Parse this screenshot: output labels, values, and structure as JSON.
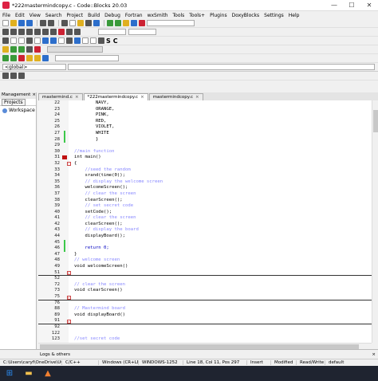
{
  "window": {
    "title": "*222mastermindcopy.c - Code::Blocks 20.03",
    "minimize": "—",
    "maximize": "☐",
    "close": "✕"
  },
  "menu": [
    "File",
    "Edit",
    "View",
    "Search",
    "Project",
    "Build",
    "Debug",
    "Fortran",
    "wxSmith",
    "Tools",
    "Tools+",
    "Plugins",
    "DoxyBlocks",
    "Settings",
    "Help"
  ],
  "scope": {
    "value": "<global>"
  },
  "management": {
    "title": "Management",
    "close": "×",
    "tab": "Projects",
    "workspace": "Workspace"
  },
  "tabs": [
    {
      "label": "mastermind.c",
      "active": false
    },
    {
      "label": "*222mastermindcopy.c",
      "active": true
    },
    {
      "label": "mastermindcopy.c",
      "active": false
    }
  ],
  "colors": {
    "breakpoint": "#c01010",
    "change_marker": "#3cc84a",
    "comment": "#8888ff",
    "number": "#f07000"
  },
  "lines": [
    {
      "n": "22",
      "code": "        NAVY,"
    },
    {
      "n": "23",
      "code": "        ORANGE,"
    },
    {
      "n": "24",
      "code": "        PINK,"
    },
    {
      "n": "25",
      "code": "        RED,"
    },
    {
      "n": "26",
      "code": "        VIOLET,"
    },
    {
      "n": "27",
      "code": "        WHITE",
      "green": true
    },
    {
      "n": "28",
      "code": "        }",
      "green": true,
      "fold_end": true
    },
    {
      "n": "29",
      "code": ""
    },
    {
      "n": "30",
      "code": "//main function",
      "cls": "c-com"
    },
    {
      "n": "31",
      "code": "int main()",
      "bp": true
    },
    {
      "n": "32",
      "code": "{",
      "fold": true
    },
    {
      "n": "33",
      "code": "    //seed the random",
      "cls": "c-com"
    },
    {
      "n": "34",
      "code": "    srand(time(0));"
    },
    {
      "n": "35",
      "code": "    // display the welcome screen",
      "cls": "c-com"
    },
    {
      "n": "36",
      "code": "    welcomeScreen();"
    },
    {
      "n": "37",
      "code": "    // clear the screen",
      "cls": "c-com"
    },
    {
      "n": "38",
      "code": "    clearScreen();"
    },
    {
      "n": "39",
      "code": "    // set secret code",
      "cls": "c-com"
    },
    {
      "n": "40",
      "code": "    setCode();"
    },
    {
      "n": "41",
      "code": "    // clear the screen",
      "cls": "c-com"
    },
    {
      "n": "42",
      "code": "    clearScreen();"
    },
    {
      "n": "43",
      "code": "    // display the board",
      "cls": "c-com"
    },
    {
      "n": "44",
      "code": "    displayBoard();"
    },
    {
      "n": "45",
      "code": "",
      "green": true
    },
    {
      "n": "46",
      "code": "    return 0;",
      "green": true,
      "kw": true
    },
    {
      "n": "47",
      "code": "}",
      "fold_end": true
    },
    {
      "n": "48",
      "code": "// welcome screen",
      "cls": "c-com"
    },
    {
      "n": "49",
      "code": "void welcomeScreen()"
    },
    {
      "n": "51",
      "code": "",
      "collapsed": true
    },
    {
      "n": "52",
      "code": ""
    },
    {
      "n": "72",
      "code": "// clear the screen",
      "cls": "c-com"
    },
    {
      "n": "73",
      "code": "void clearScreen()"
    },
    {
      "n": "75",
      "code": "",
      "collapsed": true
    },
    {
      "n": "76",
      "code": ""
    },
    {
      "n": "88",
      "code": "// Mastermind board",
      "cls": "c-com"
    },
    {
      "n": "89",
      "code": "void displayBoard()"
    },
    {
      "n": "91",
      "code": "",
      "collapsed": true
    },
    {
      "n": "92",
      "code": ""
    },
    {
      "n": "122",
      "code": ""
    },
    {
      "n": "123",
      "code": "//set secret code",
      "cls": "c-com"
    }
  ],
  "logs": {
    "label": "Logs & others",
    "close": "×"
  },
  "status": {
    "path": "C:\\Users\\caryf\\OneDrive\\UCF\\...",
    "lang": "C/C++",
    "eol": "Windows (CR+LF)",
    "encoding": "WINDOWS-1252",
    "position": "Line 18, Col 11, Pos 297",
    "mode": "Insert",
    "modified": "Modified",
    "access": "Read/Write",
    "profile": "default"
  }
}
